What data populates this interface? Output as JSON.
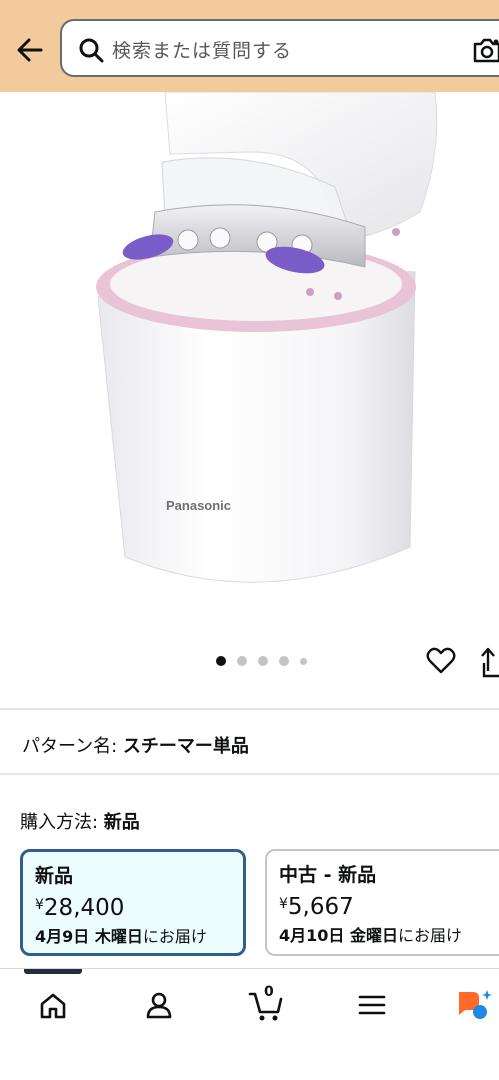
{
  "header": {
    "search_placeholder": "検索または質問する",
    "icons": [
      "back-arrow-icon",
      "search-icon",
      "camera-icon"
    ],
    "background_color": "#f2ca9c"
  },
  "product": {
    "brand_text_on_image": "Panasonic",
    "image_count": 5,
    "active_image_index": 0,
    "actions": [
      "heart-icon",
      "share-icon"
    ]
  },
  "pattern": {
    "label": "パターン名: ",
    "value": "スチーマー単品"
  },
  "purchase": {
    "label": "購入方法: ",
    "value": "新品"
  },
  "options": [
    {
      "title": "新品",
      "currency": "¥",
      "price": "28,400",
      "delivery_date": "4月9日 木曜日",
      "delivery_suffix": "にお届け",
      "selected": true
    },
    {
      "title": "中古 - 新品",
      "currency": "¥",
      "price": "5,667",
      "delivery_date": "4月10日 金曜日",
      "delivery_suffix": "にお届け",
      "selected": false
    }
  ],
  "bottom_nav": {
    "items": [
      "home-icon",
      "account-icon",
      "cart-icon",
      "menu-icon",
      "ai-assistant-icon"
    ],
    "cart_count": "0"
  },
  "colors": {
    "selected_border": "#2f5f8a",
    "selected_bg": "#edfdff",
    "ai_orange": "#ff6a2b",
    "ai_blue": "#1e88e5"
  }
}
